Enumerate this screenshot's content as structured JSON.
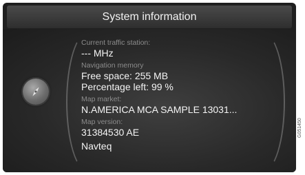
{
  "header": {
    "title": "System information"
  },
  "info": {
    "traffic_label": "Current traffic station:",
    "traffic_value": "--- MHz",
    "nav_label": "Navigation memory",
    "free_space": "Free space: 255 MB",
    "percent_left": "Percentage left: 99 %",
    "market_label": "Map market:",
    "market_value": "N.AMERICA MCA SAMPLE 13031...",
    "version_label": "Map version:",
    "version_value": "31384530 AE",
    "provider_value": "Navteq"
  },
  "image_code": "G051450",
  "icons": {
    "knob": "navigation-dial-icon"
  }
}
